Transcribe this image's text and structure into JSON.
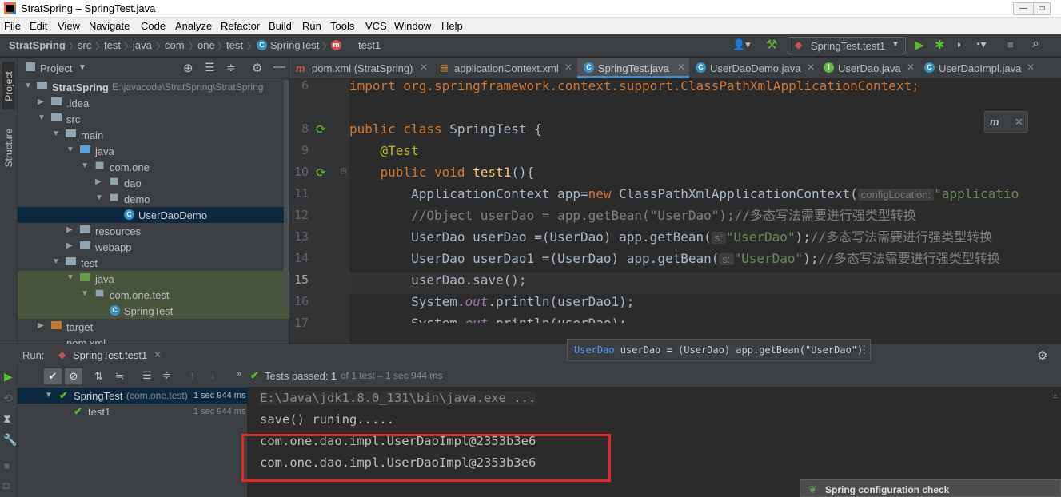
{
  "window": {
    "title": "StratSpring – SpringTest.java",
    "min": "—",
    "max": "▭",
    "close": "✕"
  },
  "menu": [
    "File",
    "Edit",
    "View",
    "Navigate",
    "Code",
    "Analyze",
    "Refactor",
    "Build",
    "Run",
    "Tools",
    "VCS",
    "Window",
    "Help"
  ],
  "breadcrumb": [
    "StratSpring",
    "src",
    "test",
    "java",
    "com",
    "one",
    "test",
    "SpringTest",
    "test1"
  ],
  "run_config": "SpringTest.test1",
  "project_panel": {
    "title": "Project",
    "root": {
      "name": "StratSpring",
      "path": "E:\\javacode\\StratSpring\\StratSpring"
    },
    "items": [
      {
        "label": ".idea",
        "type": "folder"
      },
      {
        "label": "src",
        "type": "folder"
      },
      {
        "label": "main",
        "type": "folder"
      },
      {
        "label": "java",
        "type": "folder-blue"
      },
      {
        "label": "com.one",
        "type": "package"
      },
      {
        "label": "dao",
        "type": "package"
      },
      {
        "label": "demo",
        "type": "package"
      },
      {
        "label": "UserDaoDemo",
        "type": "class",
        "selected": true
      },
      {
        "label": "resources",
        "type": "folder"
      },
      {
        "label": "webapp",
        "type": "folder"
      },
      {
        "label": "test",
        "type": "folder"
      },
      {
        "label": "java",
        "type": "folder-green"
      },
      {
        "label": "com.one.test",
        "type": "package"
      },
      {
        "label": "SpringTest",
        "type": "class"
      },
      {
        "label": "target",
        "type": "folder-orange"
      },
      {
        "label": "pom.xml",
        "type": "file"
      }
    ]
  },
  "side_tabs": {
    "project": "Project",
    "structure": "Structure"
  },
  "editor_tabs": [
    {
      "label": "pom.xml (StratSpring)",
      "icon": "m"
    },
    {
      "label": "applicationContext.xml",
      "icon": "xml"
    },
    {
      "label": "SpringTest.java",
      "icon": "c",
      "active": true
    },
    {
      "label": "UserDaoDemo.java",
      "icon": "c"
    },
    {
      "label": "UserDao.java",
      "icon": "i"
    },
    {
      "label": "UserDaoImpl.java",
      "icon": "c"
    }
  ],
  "code": {
    "line_numbers": [
      "6",
      "8",
      "9",
      "10",
      "11",
      "12",
      "13",
      "14",
      "15",
      "16",
      "17"
    ],
    "l6": "import org.springframework.context.support.ClassPathXmlApplicationContext;",
    "l8_kw": "public class",
    "l8_rest": " SpringTest {",
    "l9": "@Test",
    "l10_kw": "public void",
    "l10_fn": "test1",
    "l10_rest": "(){",
    "l11_a": "ApplicationContext app=",
    "l11_kw": "new",
    "l11_b": " ClassPathXmlApplicationContext(",
    "l11_hint": "configLocation:",
    "l11_str": "\"applicatio",
    "l12": "//Object userDao = app.getBean(\"UserDao\");//多态写法需要进行强类型转换",
    "l13_a": "UserDao userDao =(UserDao) app.getBean(",
    "l13_hint": "s:",
    "l13_str": "\"UserDao\"",
    "l13_b": ");",
    "l13_cm": "//多态写法需要进行强类型转换",
    "l14_a": "UserDao userDao1 =(UserDao) app.getBean(",
    "l14_hint": "s:",
    "l14_str": "\"UserDao\"",
    "l14_b": ");",
    "l14_cm": "//多态写法需要进行强类型转换",
    "l15": "userDao.save();",
    "l16_a": "System.",
    "l16_it": "out",
    "l16_b": ".println(userDao1);",
    "l17_a": "System.",
    "l17_it": "out",
    "l17_b": ".println(userDao);"
  },
  "tooltip": {
    "type": "UserDao",
    "rest": " userDao = (UserDao) app.getBean(\"UserDao\")"
  },
  "run": {
    "label": "Run:",
    "tab": "SpringTest.test1",
    "status": "Tests passed:",
    "passed": "1",
    "detail": "of 1 test – 1 sec 944 ms",
    "tree": [
      {
        "label": "SpringTest",
        "sub": "(com.one.test)",
        "time": "1 sec 944 ms"
      },
      {
        "label": "test1",
        "time": "1 sec 944 ms"
      }
    ],
    "console": [
      "E:\\Java\\jdk1.8.0_131\\bin\\java.exe ...",
      "save() runing.....",
      "com.one.dao.impl.UserDaoImpl@2353b3e6",
      "com.one.dao.impl.UserDaoImpl@2353b3e6"
    ]
  },
  "notification": "Spring configuration check",
  "colors": {
    "accent": "#4a88c7",
    "pass": "#5fb832",
    "highlight_box": "#e8252a"
  }
}
